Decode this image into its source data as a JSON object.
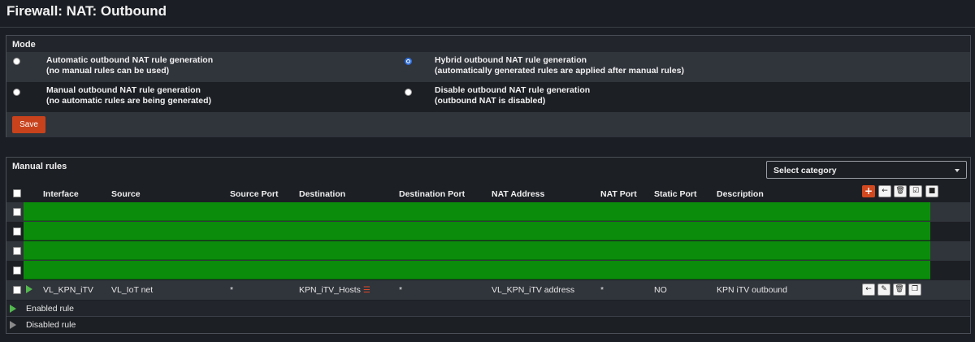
{
  "page": {
    "title": "Firewall: NAT: Outbound"
  },
  "mode": {
    "title": "Mode",
    "options": [
      {
        "line1": "Automatic outbound NAT rule generation",
        "line2": "(no manual rules can be used)",
        "selected": false
      },
      {
        "line1": "Hybrid outbound NAT rule generation",
        "line2": "(automatically generated rules are applied after manual rules)",
        "selected": true
      },
      {
        "line1": "Manual outbound NAT rule generation",
        "line2": "(no automatic rules are being generated)",
        "selected": false
      },
      {
        "line1": "Disable outbound NAT rule generation",
        "line2": "(outbound NAT is disabled)",
        "selected": false
      }
    ],
    "save_label": "Save"
  },
  "rules": {
    "title": "Manual rules",
    "category_select": {
      "value": "Select category"
    },
    "columns": [
      "Interface",
      "Source",
      "Source Port",
      "Destination",
      "Destination Port",
      "NAT Address",
      "NAT Port",
      "Static Port",
      "Description"
    ],
    "header_actions": [
      "add-icon",
      "arrow-left-icon",
      "trash-icon",
      "check-square-icon",
      "square-icon"
    ],
    "redacted_rows": 4,
    "row": {
      "interface": "VL_KPN_iTV",
      "source": "VL_IoT net",
      "source_port": "*",
      "destination": "KPN_iTV_Hosts",
      "destination_port": "*",
      "nat_address": "VL_KPN_iTV address",
      "nat_port": "*",
      "static_port": "NO",
      "description": "KPN iTV outbound",
      "enabled": true,
      "actions": [
        "arrow-left-icon",
        "pencil-icon",
        "trash-icon",
        "clone-icon"
      ]
    },
    "legend": {
      "enabled": "Enabled rule",
      "disabled": "Disabled rule"
    }
  },
  "colors": {
    "accent": "#c8421c",
    "redaction": "#0b8c0b",
    "enabled": "#53b84e",
    "disabled": "#8a8a8a",
    "radio_selected": "#2f6fdc"
  }
}
